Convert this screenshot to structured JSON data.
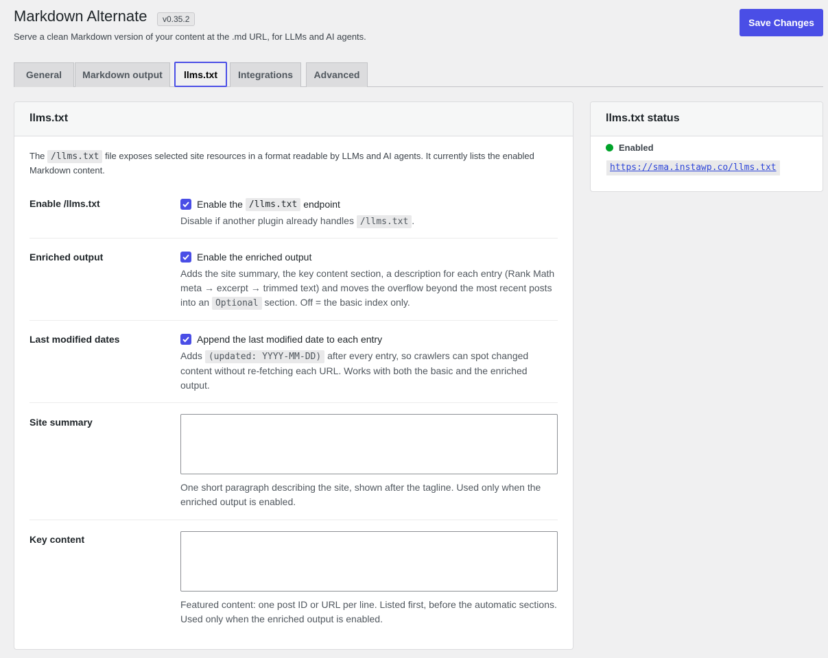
{
  "header": {
    "title": "Markdown Alternate",
    "version": "v0.35.2",
    "description": "Serve a clean Markdown version of your content at the .md URL, for LLMs and AI agents.",
    "save_label": "Save Changes"
  },
  "tabs": [
    {
      "label": "General"
    },
    {
      "label": "Markdown output"
    },
    {
      "label": "llms.txt",
      "active": true
    },
    {
      "label": "Integrations"
    },
    {
      "label": "Advanced"
    }
  ],
  "main": {
    "title": "llms.txt",
    "intro_pre": "The",
    "intro_code": "/llms.txt",
    "intro_post": "file exposes selected site resources in a format readable by LLMs and AI agents. It currently lists the enabled Markdown content.",
    "settings": {
      "enable": {
        "label": "Enable /llms.txt",
        "checked": true,
        "check_pre": "Enable the",
        "check_code": "/llms.txt",
        "check_post": "endpoint",
        "help_pre": "Disable if another plugin already handles",
        "help_code": "/llms.txt",
        "help_post": "."
      },
      "enriched": {
        "label": "Enriched output",
        "checked": true,
        "check_text": "Enable the enriched output",
        "help_pre": "Adds the site summary, the key content section, a description for each entry (Rank Math meta → excerpt → trimmed text) and moves the overflow beyond the most recent posts into an",
        "help_code": "Optional",
        "help_post": "section. Off = the basic index only."
      },
      "modified": {
        "label": "Last modified dates",
        "checked": true,
        "check_text": "Append the last modified date to each entry",
        "help_pre": "Adds",
        "help_code": "(updated: YYYY-MM-DD)",
        "help_post": "after every entry, so crawlers can spot changed content without re-fetching each URL. Works with both the basic and the enriched output."
      },
      "summary": {
        "label": "Site summary",
        "value": "",
        "help": "One short paragraph describing the site, shown after the tagline. Used only when the enriched output is enabled."
      },
      "key_content": {
        "label": "Key content",
        "value": "",
        "help": "Featured content: one post ID or URL per line. Listed first, before the automatic sections. Used only when the enriched output is enabled."
      }
    }
  },
  "status": {
    "title": "llms.txt status",
    "state": "Enabled",
    "state_color": "#00a32a",
    "url": "https://sma.instawp.co/llms.txt"
  },
  "colors": {
    "accent": "#4a4ee6"
  }
}
